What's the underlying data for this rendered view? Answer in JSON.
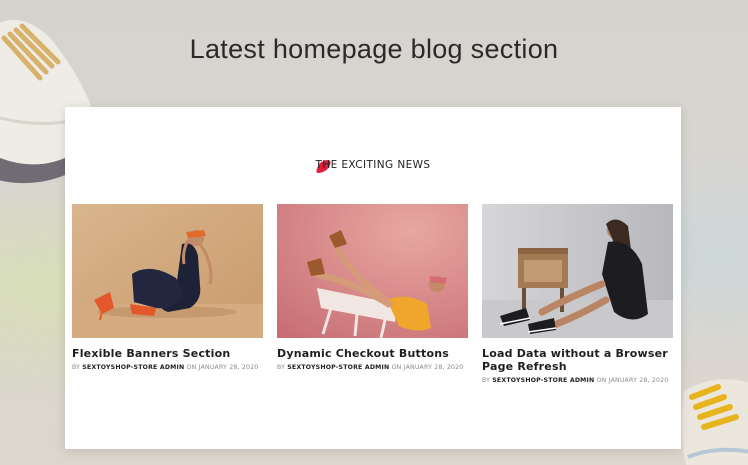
{
  "hero": {
    "title": "Latest homepage blog section"
  },
  "section": {
    "heading": "THE EXCITING NEWS",
    "accent_color": "#e11d3c"
  },
  "posts": [
    {
      "title": "Flexible Banners Section",
      "by": "BY",
      "author": "SEXTOYSHOP-STORE ADMIN",
      "on": "ON",
      "date": "JANUARY 28, 2020",
      "image_icon": "woman-orange-heels-photo"
    },
    {
      "title": "Dynamic Checkout Buttons",
      "by": "BY",
      "author": "SEXTOYSHOP-STORE ADMIN",
      "on": "ON",
      "date": "JANUARY 28, 2020",
      "image_icon": "woman-pink-chair-photo"
    },
    {
      "title": "Load Data without a Browser Page Refresh",
      "by": "BY",
      "author": "SEXTOYSHOP-STORE ADMIN",
      "on": "ON",
      "date": "JANUARY 28, 2020",
      "image_icon": "woman-record-player-photo"
    }
  ]
}
